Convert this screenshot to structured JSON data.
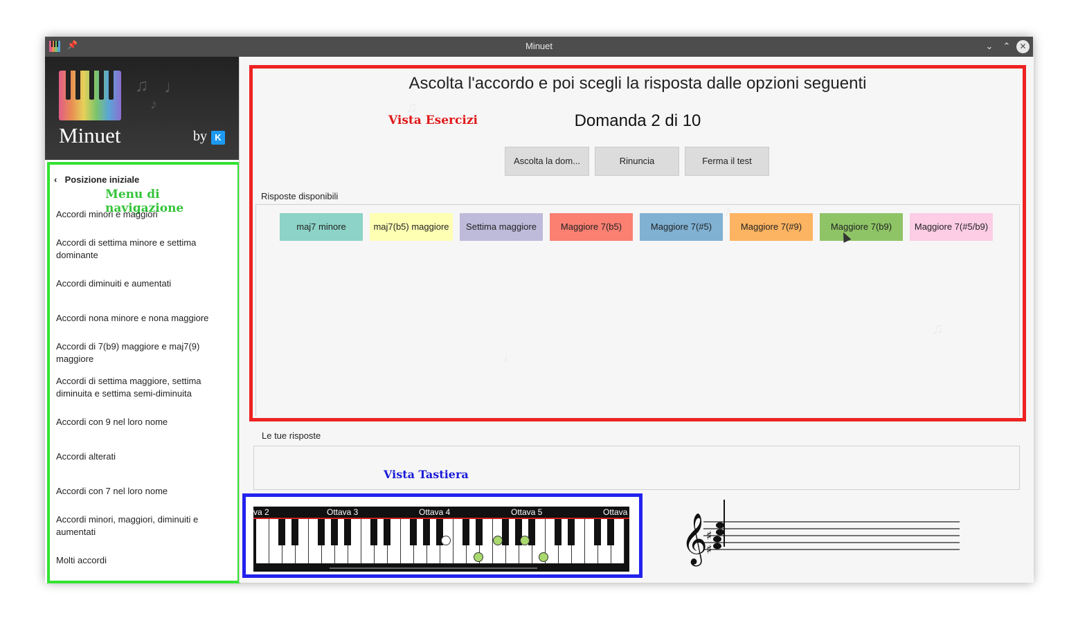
{
  "window": {
    "title": "Minuet"
  },
  "brand": {
    "app_name": "Minuet",
    "by": "by",
    "kde": "K"
  },
  "nav": {
    "back_label": "Posizione iniziale",
    "caption": "Menu di navigazione",
    "items": [
      "Accordi minori e maggiori",
      "Accordi di settima minore e settima dominante",
      "Accordi diminuiti e aumentati",
      "Accordi nona minore e nona maggiore",
      "Accordi di 7(b9) maggiore e maj7(9) maggiore",
      "Accordi di settima maggiore, settima diminuita e settima semi-diminuita",
      "Accordi con 9 nel loro nome",
      "Accordi alterati",
      "Accordi con 7 nel loro nome",
      "Accordi minori, maggiori, diminuiti e aumentati",
      "Molti accordi"
    ]
  },
  "exercise": {
    "instruction": "Ascolta l'accordo e poi scegli la risposta dalle opzioni seguenti",
    "caption": "Vista Esercizi",
    "question": "Domanda 2 di 10",
    "buttons": {
      "listen": "Ascolta la dom...",
      "give_up": "Rinuncia",
      "stop": "Ferma il test"
    },
    "answers_label": "Risposte disponibili",
    "answers": [
      {
        "label": "maj7 minore",
        "color": "#8dd3c7"
      },
      {
        "label": "maj7(b5) maggiore",
        "color": "#ffffb3"
      },
      {
        "label": "Settima maggiore",
        "color": "#bebada"
      },
      {
        "label": "Maggiore 7(b5)",
        "color": "#fb8072"
      },
      {
        "label": "Maggiore 7(#5)",
        "color": "#80b1d3"
      },
      {
        "label": "Maggiore 7(#9)",
        "color": "#fdb462"
      },
      {
        "label": "Maggiore 7(b9)",
        "color": "#8fc466"
      },
      {
        "label": "Maggiore 7(#5/b9)",
        "color": "#fccde5"
      }
    ]
  },
  "responses": {
    "label": "Le tue risposte",
    "caption": "Vista Tastiera"
  },
  "keyboard": {
    "octaves": [
      "va 2",
      "Ottava 3",
      "Ottava 4",
      "Ottava 5",
      "Ottava"
    ]
  },
  "colors": {
    "exercise_border": "#ee2222",
    "nav_border": "#34e234",
    "keyboard_border": "#2222ee",
    "note_marker": "#a9d86e"
  }
}
